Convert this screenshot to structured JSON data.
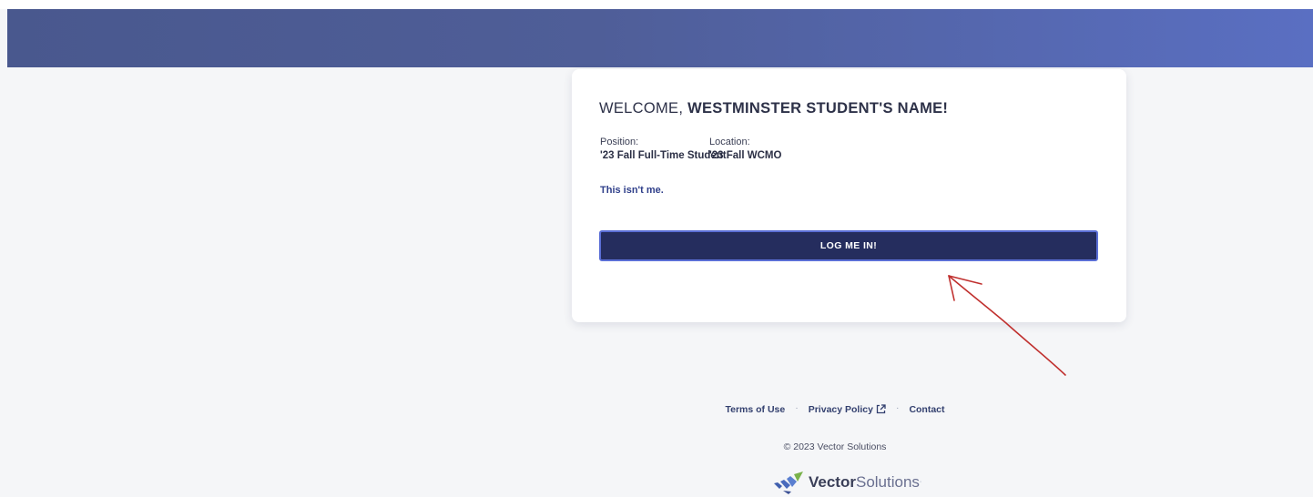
{
  "card": {
    "welcome_prefix": "WELCOME, ",
    "welcome_name": "WESTMINSTER STUDENT'S NAME!",
    "position_label": "Position:",
    "position_value": "'23 Fall Full-Time Student",
    "location_label": "Location:",
    "location_value": "'23 Fall WCMO",
    "not_me_link": "This isn't me.",
    "login_button": "LOG ME IN!"
  },
  "footer": {
    "links": [
      "Terms of Use",
      "Privacy Policy",
      "Contact"
    ],
    "separator": "·",
    "copyright": "© 2023 Vector Solutions"
  },
  "brand": {
    "name_bold": "Vector",
    "name_light": "Solutions",
    "trademark": "·"
  },
  "colors": {
    "header_gradient_start": "#49588e",
    "header_gradient_end": "#5a6fc2",
    "button_background": "#252d5e",
    "button_border": "#5b6fd6",
    "link_color": "#2f3f8a",
    "annotation_ink": "#c0302e"
  },
  "icons": {
    "external_link": "external-link-icon",
    "logo": "vector-solutions-logo-icon"
  }
}
